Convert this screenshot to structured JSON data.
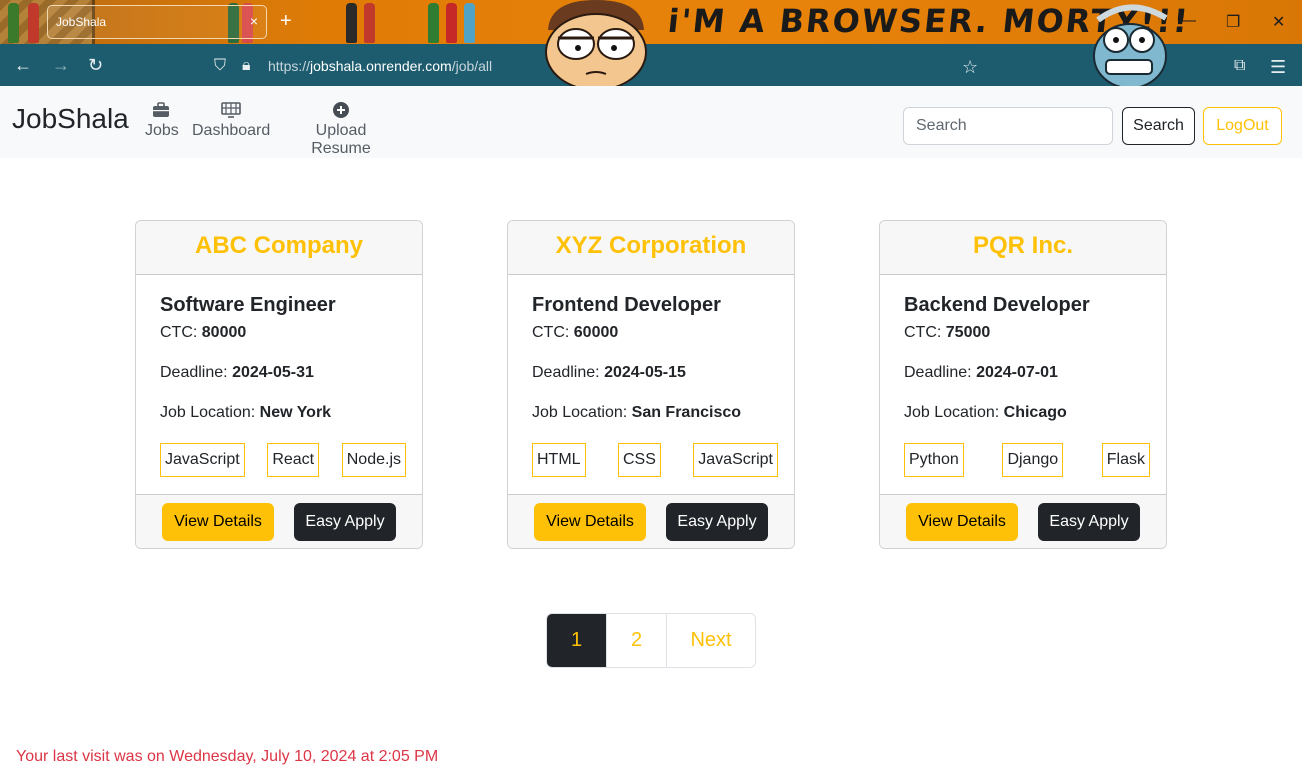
{
  "browser": {
    "tab_title": "JobShala",
    "new_tab": "+",
    "tab_close": "×",
    "banner": "i'M A BROWSER. MORTY!!!",
    "url_prefix": "https://",
    "url_host": "jobshala.onrender.com",
    "url_path": "/job/all",
    "window_controls": [
      "—",
      "❐",
      "✕"
    ]
  },
  "navbar": {
    "brand": "JobShala",
    "items": [
      {
        "label": "Jobs",
        "icon": "briefcase-icon"
      },
      {
        "label": "Dashboard",
        "icon": "dashboard-icon"
      },
      {
        "label": "Upload Resume",
        "icon": "plus-circle-icon"
      }
    ],
    "search": {
      "placeholder": "Search",
      "button": "Search"
    },
    "logout": "LogOut"
  },
  "labels": {
    "ctc": "CTC:",
    "deadline": "Deadline:",
    "location": "Job Location:",
    "view_details": "View Details",
    "easy_apply": "Easy Apply"
  },
  "jobs": [
    {
      "company": "ABC Company",
      "title": "Software Engineer",
      "ctc": "80000",
      "deadline": "2024-05-31",
      "location": "New York",
      "skills": [
        "JavaScript",
        "React",
        "Node.js"
      ]
    },
    {
      "company": "XYZ Corporation",
      "title": "Frontend Developer",
      "ctc": "60000",
      "deadline": "2024-05-15",
      "location": "San Francisco",
      "skills": [
        "HTML",
        "CSS",
        "JavaScript"
      ]
    },
    {
      "company": "PQR Inc.",
      "title": "Backend Developer",
      "ctc": "75000",
      "deadline": "2024-07-01",
      "location": "Chicago",
      "skills": [
        "Python",
        "Django",
        "Flask"
      ]
    }
  ],
  "pagination": {
    "pages": [
      "1",
      "2"
    ],
    "active": "1",
    "next": "Next"
  },
  "footer": {
    "last_visit": "Your last visit was on Wednesday, July 10, 2024 at 2:05 PM"
  },
  "colors": {
    "accent": "#ffc107",
    "dark": "#212529",
    "danger": "#dc3545",
    "browser_toolbar": "#1d5c6e",
    "browser_tabbar": "#e8830a"
  }
}
